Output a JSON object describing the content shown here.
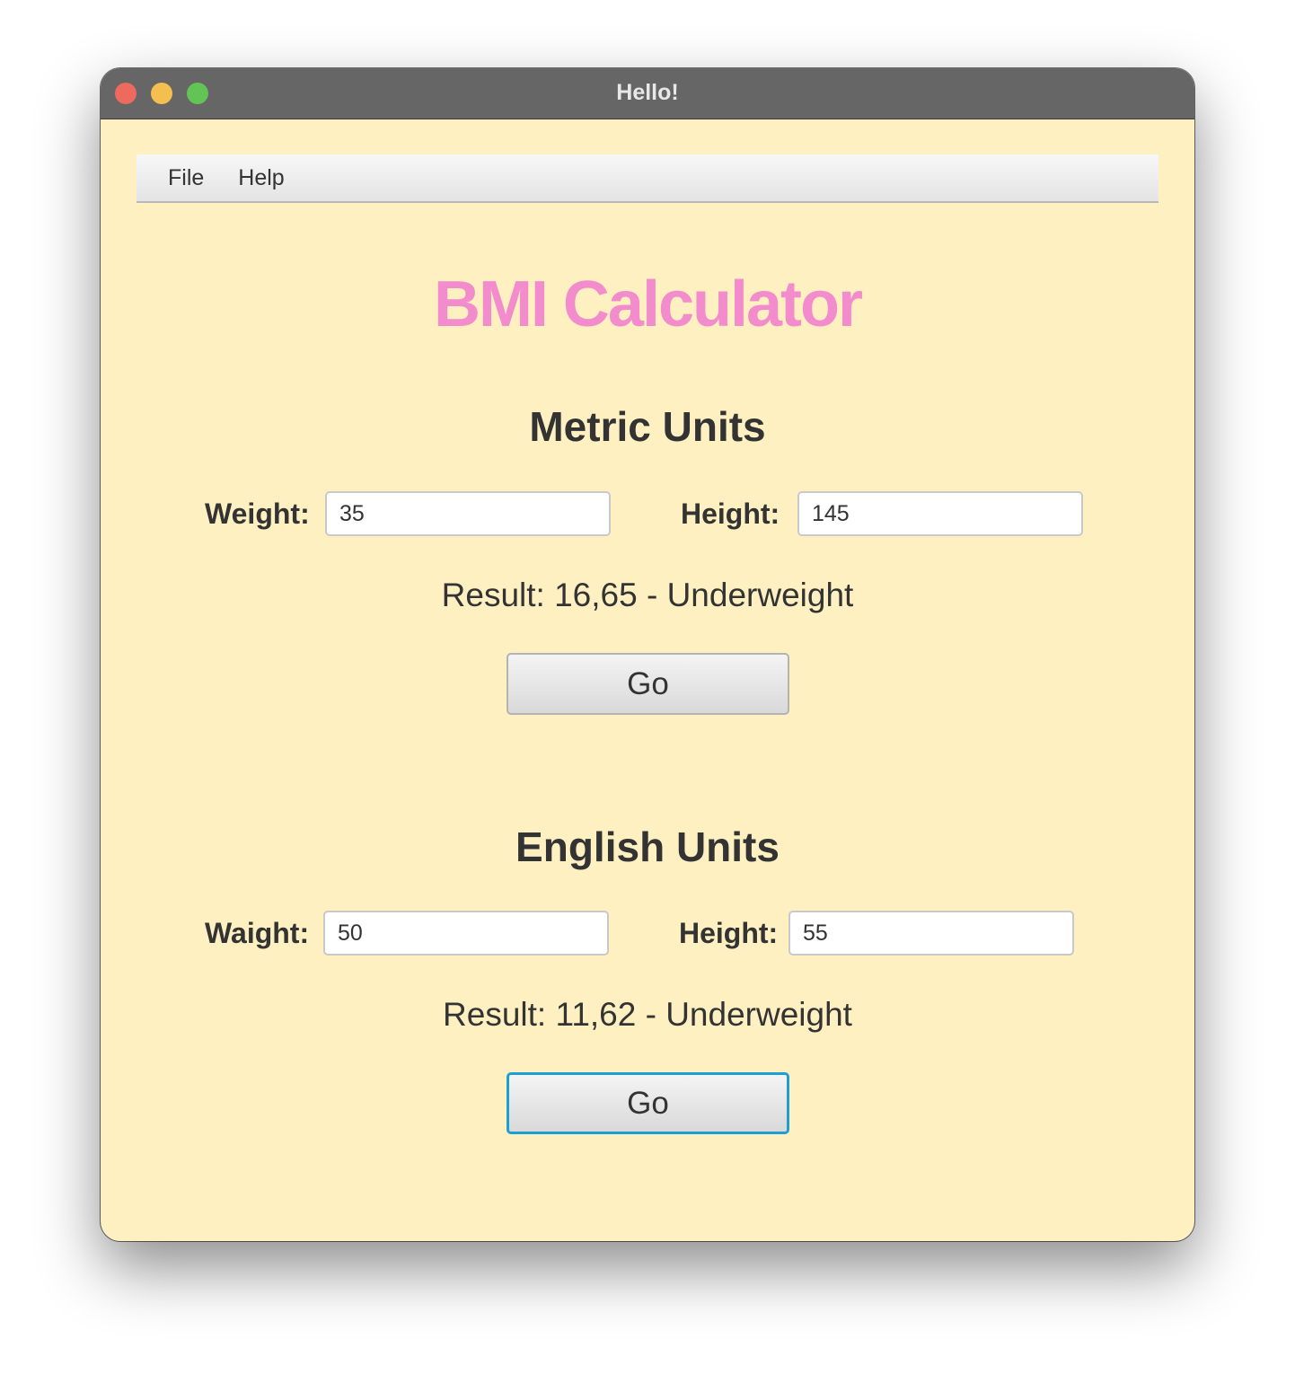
{
  "window": {
    "title": "Hello!"
  },
  "menubar": {
    "items": [
      "File",
      "Help"
    ]
  },
  "app_title": "BMI Calculator",
  "metric": {
    "section_title": "Metric Units",
    "weight_label": "Weight:",
    "weight_value": "35",
    "height_label": "Height:",
    "height_value": "145",
    "result": "Result: 16,65 - Underweight",
    "go_label": "Go"
  },
  "english": {
    "section_title": "English Units",
    "weight_label": "Waight:",
    "weight_value": "50",
    "height_label": "Height:",
    "height_value": "55",
    "result": "Result: 11,62 - Underweight",
    "go_label": "Go"
  },
  "colors": {
    "background": "#fff0c1",
    "titlebar": "#666666",
    "title_accent": "#f28ccc",
    "focus_ring": "#1e9fd4"
  }
}
